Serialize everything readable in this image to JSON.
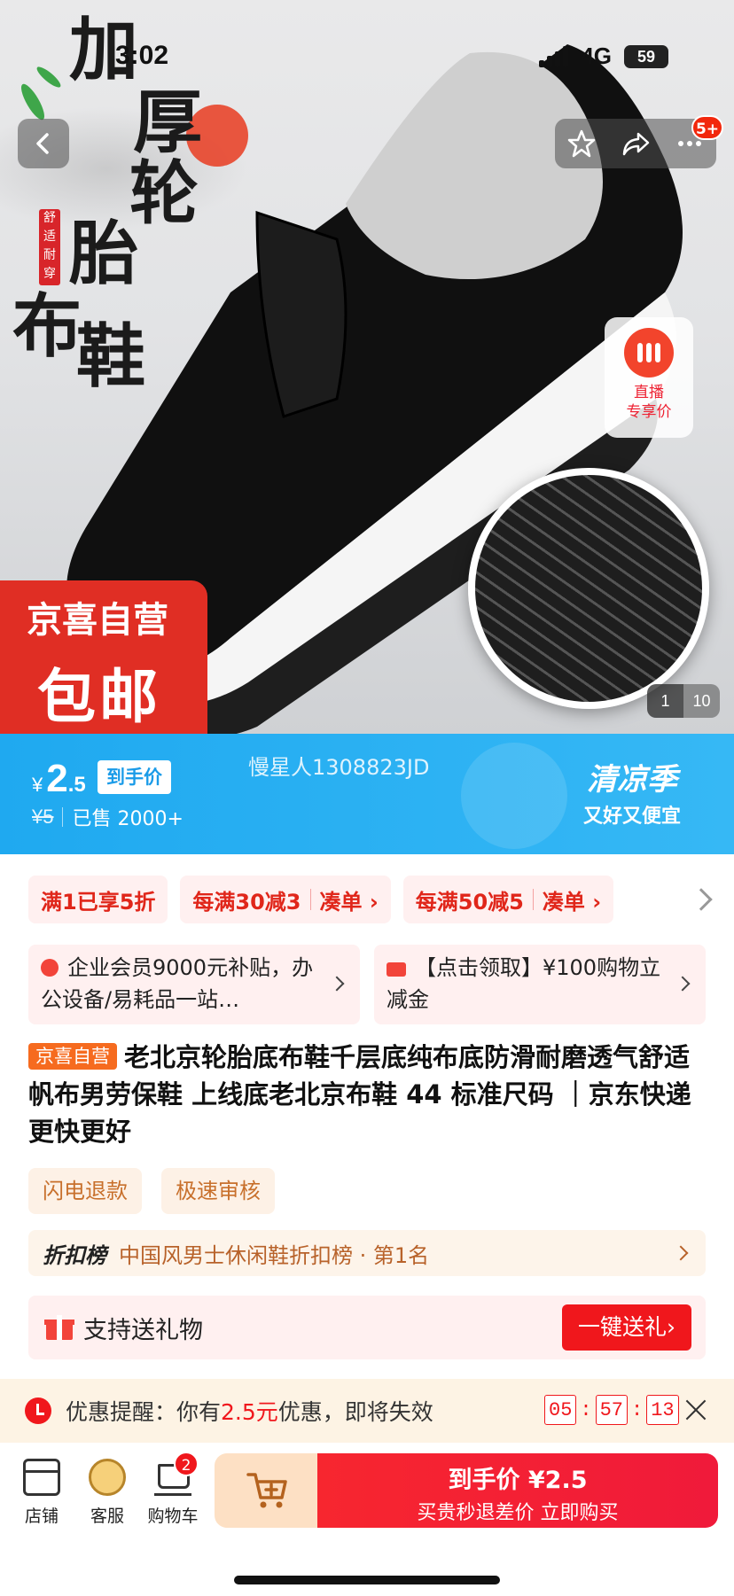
{
  "status_bar": {
    "time": "3:02",
    "network": "4G",
    "battery": "59"
  },
  "hero": {
    "calligraphy": [
      "加",
      "厚",
      "轮",
      "胎",
      "布",
      "鞋"
    ],
    "seal_text": "舒适耐穿",
    "self_badge_line1": "京喜自营",
    "self_badge_line2": "包邮",
    "live_label_line1": "直播",
    "live_label_line2": "专享价",
    "pager_current": "1",
    "pager_total": "10",
    "notification_badge": "5+"
  },
  "price": {
    "currency": "¥",
    "integer": "2",
    "decimal": ".5",
    "label": "到手价",
    "original": "¥5",
    "sold": "已售 2000+",
    "watermark": "慢星人1308823JD",
    "season_title": "清凉季",
    "season_sub": "又好又便宜"
  },
  "promos": {
    "chip1": "满1已享5折",
    "chip2_main": "每满30减3",
    "chip2_action": "凑单 ›",
    "chip3_main": "每满50减5",
    "chip3_action": "凑单 ›"
  },
  "benefit_cards": {
    "card1": "企业会员9000元补贴，办公设备/易耗品一站…",
    "card2": "【点击领取】¥100购物立减金"
  },
  "product": {
    "tag": "京喜自营",
    "title": "老北京轮胎底布鞋千层底纯布底防滑耐磨透气舒适帆布男劳保鞋 上线底老北京布鞋 44 标准尺码 ｜京东快递 更快更好"
  },
  "service_tags": [
    "闪电退款",
    "极速审核"
  ],
  "rank": {
    "label": "折扣榜",
    "value": "中国风男士休闲鞋折扣榜 · 第1名"
  },
  "gift": {
    "label": "支持送礼物",
    "button": "一键送礼›"
  },
  "reminder": {
    "prefix": "优惠提醒：你有",
    "amount": "2.5元",
    "suffix": "优惠，即将失效",
    "timer_h": "05",
    "timer_m": "57",
    "timer_s": "13"
  },
  "bottom_bar": {
    "store": "店铺",
    "service": "客服",
    "cart": "购物车",
    "cart_count": "2",
    "buy_line1": "到手价 ¥2.5",
    "buy_line2": "买贵秒退差价 立即购买"
  },
  "colors": {
    "brand_red": "#f0171c",
    "price_blue": "#1fa9f0",
    "tag_orange": "#f66b1f"
  }
}
